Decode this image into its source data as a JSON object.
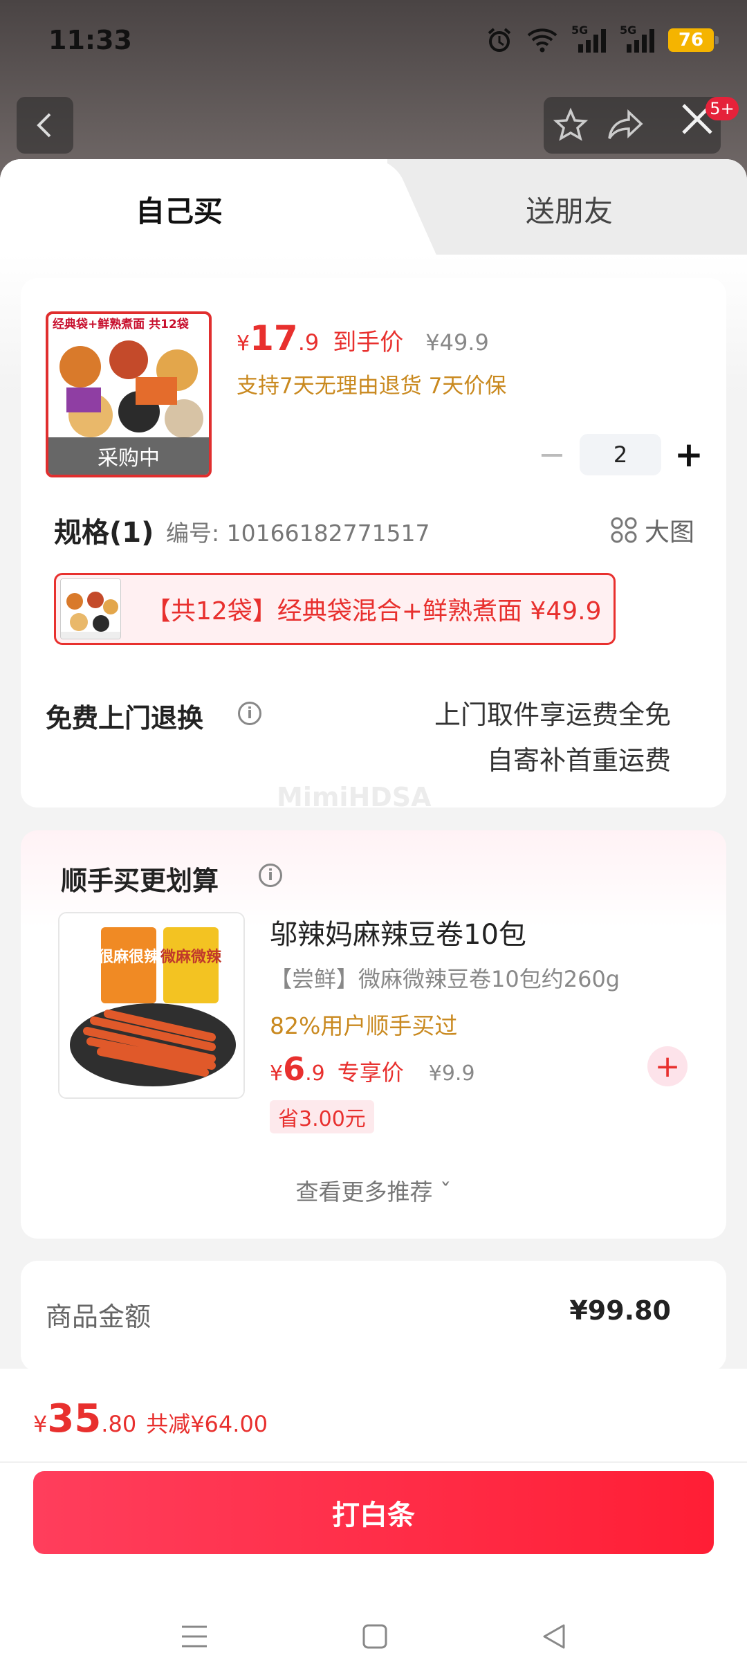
{
  "status_bar": {
    "time": "11:33",
    "battery": "76",
    "network_labels": [
      "5G",
      "5G"
    ]
  },
  "header": {
    "notification_badge": "5+"
  },
  "tabs": [
    {
      "label": "自己买"
    },
    {
      "label": "送朋友"
    }
  ],
  "product": {
    "image_header_text": "经典袋+鲜熟煮面 共12袋",
    "image_overlay": "采购中",
    "price": {
      "symbol": "¥",
      "integer": "17",
      "decimal": ".9",
      "tag": "到手价",
      "original": "¥49.9"
    },
    "promise": "支持7天无理由退货 7天价保",
    "quantity": "2",
    "spec_title": "规格(1)",
    "spec_code": "编号: 10166182771517",
    "big_view_label": "大图",
    "spec_option": "【共12袋】经典袋混合+鲜熟煮面  ¥49.9",
    "return_title": "免费上门退换",
    "return_line1": "上门取件享运费全免",
    "return_line2": "自寄补首重运费"
  },
  "watermark": "MimiHDSA",
  "addon": {
    "title": "顺手买更划算",
    "item_name": "邬辣妈麻辣豆卷10包",
    "item_desc": "【尝鲜】微麻微辣豆卷10包约260g",
    "bought_pct": "82%用户顺手买过",
    "price": {
      "symbol": "¥",
      "integer": "6",
      "decimal": ".9",
      "tag": "专享价",
      "original": "¥9.9"
    },
    "save_badge": "省3.00元",
    "package_labels": [
      "很麻很辣",
      "微麻微辣"
    ],
    "more_label": "查看更多推荐 ˇ"
  },
  "summary": {
    "label": "商品金额",
    "value": "¥99.80"
  },
  "footer": {
    "total": {
      "symbol": "¥",
      "integer": "35",
      "decimal": ".80",
      "discount": "共减¥64.00"
    },
    "pay_button": "打白条"
  },
  "colors": {
    "accent_red": "#e8302e",
    "promise_orange": "#c9891f",
    "pay_gradient_start": "#ff3e5c",
    "pay_gradient_end": "#ff1e35"
  },
  "icons": [
    "back-icon",
    "star-icon",
    "share-icon",
    "close-icon",
    "grid-icon",
    "info-icon",
    "plus-icon",
    "minus-icon",
    "menu-icon",
    "home-icon",
    "back-nav-icon"
  ]
}
